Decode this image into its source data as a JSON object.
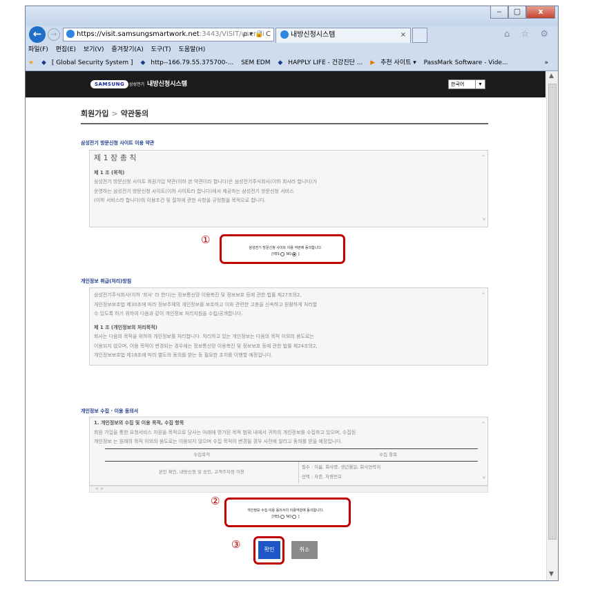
{
  "window": {
    "controls": [
      "‒",
      "▢",
      "x"
    ]
  },
  "nav": {
    "back": "←",
    "forward": "→",
    "url_main": "https://visit.samsungsmartwork.net",
    "url_rest": ":3443/VISIT/user.di",
    "url_tools": "ρ ▾ 🔒 C",
    "tab_title": "내방신청시스템",
    "tab_close": "×",
    "icons": "⌂ ☆ ⚙"
  },
  "menu": [
    "파일(F)",
    "편집(E)",
    "보기(V)",
    "즐겨찾기(A)",
    "도구(T)",
    "도움말(H)"
  ],
  "favorites": [
    "[ Global Security System ]",
    "http--166.79.55.375700-...",
    "SEM EDM",
    "HAPPLY LIFE - 건강진단 ...",
    "추천 사이트 ▾",
    "PassMark Software - Vide..."
  ],
  "favorites_more": "»",
  "site": {
    "logo": "SAMSUNG",
    "logo_sub": "삼성전기",
    "name": "내방신청시스템",
    "lang": "한국어"
  },
  "breadcrumb": {
    "first": "회원가입",
    "sep": ">",
    "second": "약관동의"
  },
  "terms": {
    "title": "삼성전기 방문신청 사이트 이용 약관",
    "chapter": "제 1 장 총 칙",
    "article": "제 1 조 (목적)",
    "lines": [
      "삼성전기 방문신청 사이트 회원가입 약관(이하 본 약관이라 합니다)은 삼성전기주식회사(이하 회사라 합니다)가",
      "운영하는 삼성전기 방문신청 사이트(이하 사이트라 합니다)에서 제공하는 삼성전기 방문신청 서비스",
      "(이하 서비스라 합니다)의 이용조건 및 절차에 관한 사항을 규정함을 목적으로 합니다."
    ],
    "agree_text": "삼성전기 방문신청 사이트 이용 약관에 동의합니다.",
    "yes": "[YES",
    "no": "NO",
    "close": "]"
  },
  "privacy": {
    "title": "개인정보 취급(처리)방침",
    "lines1": [
      "삼성전기주식회사(이하 '회사' 라 한다)는 정보통신망 이용촉진 및 정보보호 등에 관한 법률 제27조의2,",
      "개인정보보호법 제30조에 따라 정보주체의 개인정보를 보호하고 이와 관련한 고충을 신속하고 원활하게 처리할",
      "수 있도록 하기 위하여 다음과 같이 개인정보 처리지침을 수립/공개합니다."
    ],
    "article": "제 1 조 (개인정보의 처리목적)",
    "lines2": [
      "회사는 다음의 목적을 위하여 개인정보를 처리합니다. 처리하고 있는 개인정보는 다음의 목적 이외의 용도로는",
      "이용되지 않으며, 이용 목적이 변경되는 경우에는 정보통신망 이용촉진 및 정보보호 등에 관한 법률 제24조의2,",
      "개인정보보호법 제18조에 따라 별도의 동의를 받는 등 필요한 조치를 이행할 예정입니다."
    ]
  },
  "collect": {
    "title": "개인정보 수집 · 이용 동의서",
    "heading": "1. 개인정보의 수집 및 이용 목적, 수집 항목",
    "lines": [
      "회원 가입을 통한 요청서비스 지원을 목적으로 당사는 아래에 명기된 목적 범위 내에서 귀하의 개인정보를 수집하고 있으며, 수집된",
      "개인정보 는 원래의 목적 이외의 용도로는 이용되지 않으며 수집 목적이 변경될 경우 사전에 알리고 동의를 받을 예정입니다."
    ],
    "table": {
      "col1": "수집목적",
      "col2": "수집 항목",
      "purpose": "본인 확인, 내방신청 및 승인, 고객주차장 이용",
      "item1": "필수 : 이름, 회사명, 생년월일, 회사연락처",
      "item2": "선택 : 차종, 차량번호"
    },
    "agree_text": "개인정보 수집·이용 동의서의 이용약관에 동의합니다.",
    "yes": "[YES",
    "no": "NO",
    "close": "]",
    "hscroll": "<                                                                                                                                                        >"
  },
  "buttons": {
    "ok": "확인",
    "cancel": "취소"
  },
  "callouts": [
    "①",
    "②",
    "③"
  ],
  "scroll": {
    "up": "▲",
    "down": "▼"
  },
  "colors": {
    "callout": "#c00000",
    "ok_button": "#1d56c7",
    "header": "#1c1c1c",
    "section_title": "#1c3c8c"
  }
}
